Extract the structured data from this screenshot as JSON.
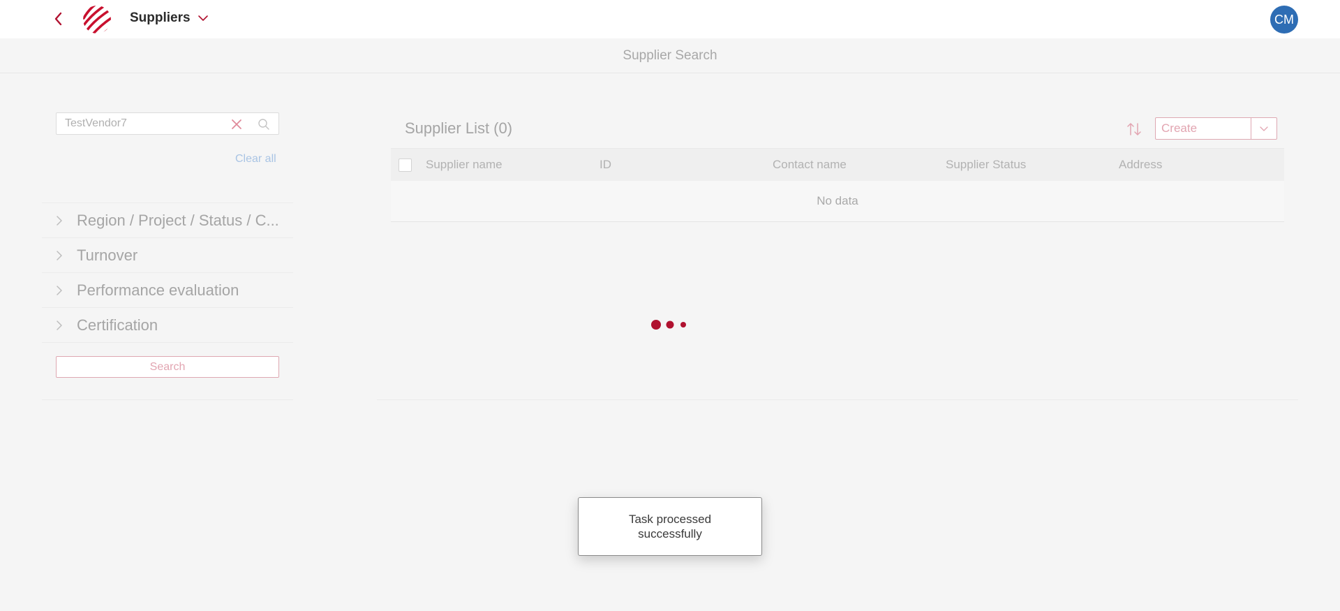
{
  "header": {
    "app_title": "Suppliers",
    "avatar_initials": "CM"
  },
  "subheader": {
    "title": "Supplier Search"
  },
  "filters": {
    "search_value": "TestVendor7",
    "clear_all_label": "Clear all",
    "items": [
      {
        "label": "Region / Project / Status / C..."
      },
      {
        "label": "Turnover"
      },
      {
        "label": "Performance evaluation"
      },
      {
        "label": "Certification"
      }
    ],
    "search_button_label": "Search"
  },
  "list": {
    "title": "Supplier List (0)",
    "create_label": "Create",
    "columns": [
      "Supplier name",
      "ID",
      "Contact name",
      "Supplier Status",
      "Address"
    ],
    "empty_text": "No data"
  },
  "toast": {
    "message": "Task processed successfully"
  },
  "colors": {
    "brand_red": "#b0112f",
    "avatar_blue": "#2e6db4",
    "link_blue": "#a9c4e4"
  },
  "icons": {
    "back": "chevron-left-icon",
    "logo": "brand-logo",
    "title_dropdown": "chevron-down-icon",
    "search_clear": "close-icon",
    "search": "search-icon",
    "filter_expand": "chevron-right-icon",
    "sort": "sort-icon",
    "create_dropdown": "chevron-down-icon",
    "loading": "loading-dots-icon"
  }
}
